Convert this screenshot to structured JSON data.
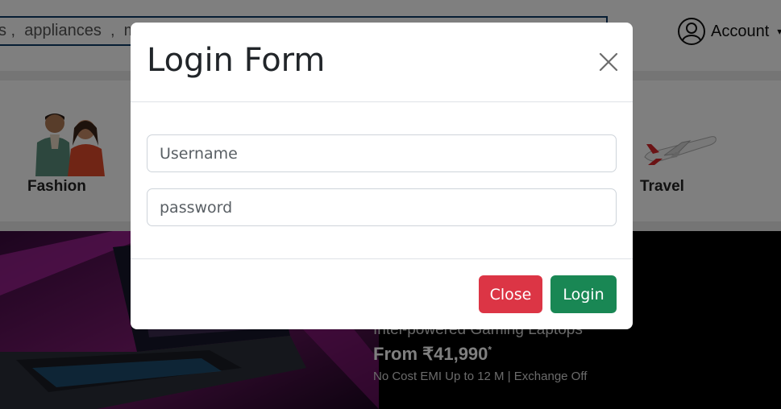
{
  "header": {
    "search_placeholder": "s ,  appliances  ,  m",
    "account_label": "Account",
    "account_caret": "▾"
  },
  "categories": [
    {
      "label": "Fashion",
      "icon": "fashion-people-icon"
    },
    {
      "label": "Travel",
      "icon": "airplane-icon"
    }
  ],
  "banner": {
    "subtitle": "Intel-powered Gaming Laptops",
    "price": "From ₹41,990",
    "price_mark": "*",
    "emi": "No Cost EMI Up to 12 M | Exchange Off"
  },
  "modal": {
    "title": "Login Form",
    "username_placeholder": "Username",
    "password_placeholder": "password",
    "close_label": "Close",
    "login_label": "Login"
  },
  "colors": {
    "close_button": "#dc3545",
    "login_button": "#198754",
    "search_border": "#0d3b66"
  }
}
